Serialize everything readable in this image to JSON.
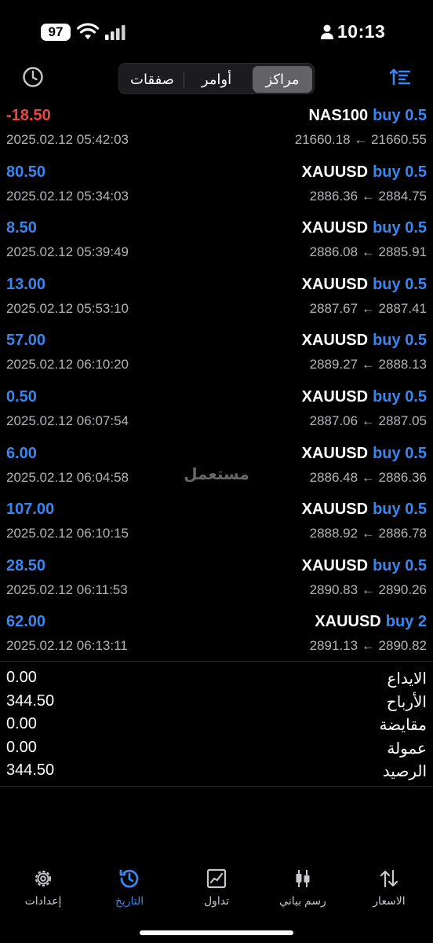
{
  "status_bar": {
    "battery": "97",
    "time": "10:13"
  },
  "segments": [
    {
      "label": "صفقات"
    },
    {
      "label": "أوامر"
    },
    {
      "label": "مراكز"
    }
  ],
  "watermark": "مستعمل",
  "trades": [
    {
      "profit": "-18.50",
      "time": "2025.02.12 05:42:03",
      "symbol": "NAS100",
      "direction": "buy 0.5",
      "prices": "21660.18 ← 21660.55",
      "negative": true
    },
    {
      "profit": "80.50",
      "time": "2025.02.12 05:34:03",
      "symbol": "XAUUSD",
      "direction": "buy 0.5",
      "prices": "2886.36 ← 2884.75"
    },
    {
      "profit": "8.50",
      "time": "2025.02.12 05:39:49",
      "symbol": "XAUUSD",
      "direction": "buy 0.5",
      "prices": "2886.08 ← 2885.91"
    },
    {
      "profit": "13.00",
      "time": "2025.02.12 05:53:10",
      "symbol": "XAUUSD",
      "direction": "buy 0.5",
      "prices": "2887.67 ← 2887.41"
    },
    {
      "profit": "57.00",
      "time": "2025.02.12 06:10:20",
      "symbol": "XAUUSD",
      "direction": "buy 0.5",
      "prices": "2889.27 ← 2888.13"
    },
    {
      "profit": "0.50",
      "time": "2025.02.12 06:07:54",
      "symbol": "XAUUSD",
      "direction": "buy 0.5",
      "prices": "2887.06 ← 2887.05"
    },
    {
      "profit": "6.00",
      "time": "2025.02.12 06:04:58",
      "symbol": "XAUUSD",
      "direction": "buy 0.5",
      "prices": "2886.48 ← 2886.36"
    },
    {
      "profit": "107.00",
      "time": "2025.02.12 06:10:15",
      "symbol": "XAUUSD",
      "direction": "buy 0.5",
      "prices": "2888.92 ← 2886.78"
    },
    {
      "profit": "28.50",
      "time": "2025.02.12 06:11:53",
      "symbol": "XAUUSD",
      "direction": "buy 0.5",
      "prices": "2890.83 ← 2890.26"
    },
    {
      "profit": "62.00",
      "time": "2025.02.12 06:13:11",
      "symbol": "XAUUSD",
      "direction": "buy 2",
      "prices": "2891.13 ← 2890.82"
    }
  ],
  "summary": [
    {
      "label": "الايداع",
      "value": "0.00"
    },
    {
      "label": "الأرباح",
      "value": "344.50"
    },
    {
      "label": "مقايضة",
      "value": "0.00"
    },
    {
      "label": "عمولة",
      "value": "0.00"
    },
    {
      "label": "الرصيد",
      "value": "344.50"
    }
  ],
  "tabs": [
    {
      "label": "إعدادات",
      "icon": "gear-icon"
    },
    {
      "label": "التاريخ",
      "icon": "history-icon",
      "active": true
    },
    {
      "label": "تداول",
      "icon": "trade-chart-icon"
    },
    {
      "label": "رسم بياني",
      "icon": "candlestick-icon"
    },
    {
      "label": "الاسعار",
      "icon": "quotes-arrows-icon"
    }
  ],
  "colors": {
    "accent": "#3a86f0",
    "negative": "#e8483f",
    "background": "#000000"
  }
}
